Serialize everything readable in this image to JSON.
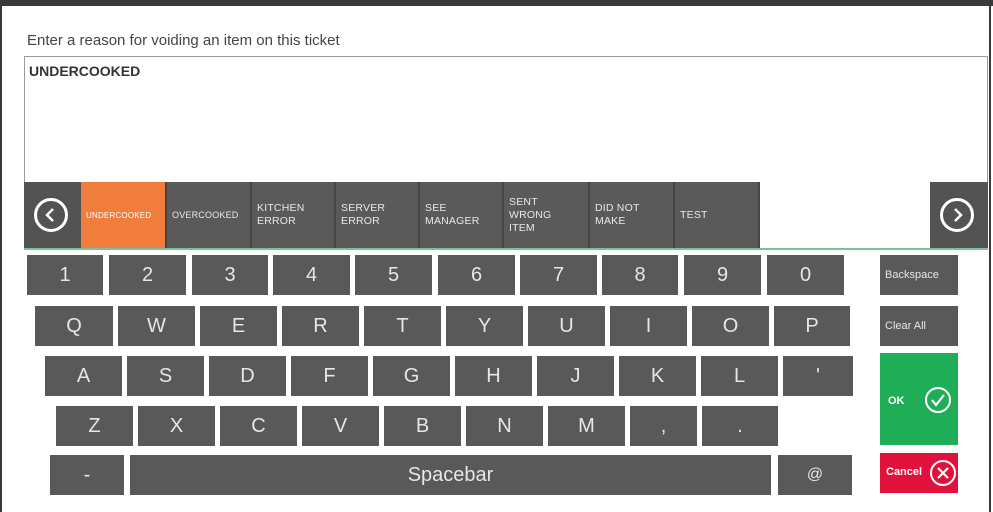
{
  "prompt": "Enter a reason for voiding an item on this ticket",
  "reason_text": "UNDERCOOKED",
  "reasons": [
    {
      "lines": [
        "UNDERCOOKED"
      ]
    },
    {
      "lines": [
        "OVERCOOKED"
      ]
    },
    {
      "lines": [
        "KITCHEN",
        "ERROR"
      ]
    },
    {
      "lines": [
        "SERVER",
        "ERROR"
      ]
    },
    {
      "lines": [
        "SEE",
        "MANAGER"
      ]
    },
    {
      "lines": [
        "SENT",
        "WRONG",
        "ITEM"
      ]
    },
    {
      "lines": [
        "DID NOT",
        "MAKE"
      ]
    },
    {
      "lines": [
        "TEST"
      ]
    }
  ],
  "selected_reason": "UNDERCOOKED",
  "keyboard": {
    "row1": [
      "1",
      "2",
      "3",
      "4",
      "5",
      "6",
      "7",
      "8",
      "9",
      "0"
    ],
    "row2": [
      "Q",
      "W",
      "E",
      "R",
      "T",
      "Y",
      "U",
      "I",
      "O",
      "P"
    ],
    "row3": [
      "A",
      "S",
      "D",
      "F",
      "G",
      "H",
      "J",
      "K",
      "L",
      "'"
    ],
    "row4": [
      "Z",
      "X",
      "C",
      "V",
      "B",
      "N",
      "M",
      ",",
      "."
    ],
    "dash": "-",
    "spacebar": "Spacebar",
    "at": "@"
  },
  "actions": {
    "backspace": "Backspace",
    "clear_all": "Clear All",
    "ok": "OK",
    "cancel": "Cancel"
  },
  "colors": {
    "selected": "#f07d3b",
    "ok": "#1fae57",
    "cancel": "#e0123c",
    "key": "#595959"
  }
}
